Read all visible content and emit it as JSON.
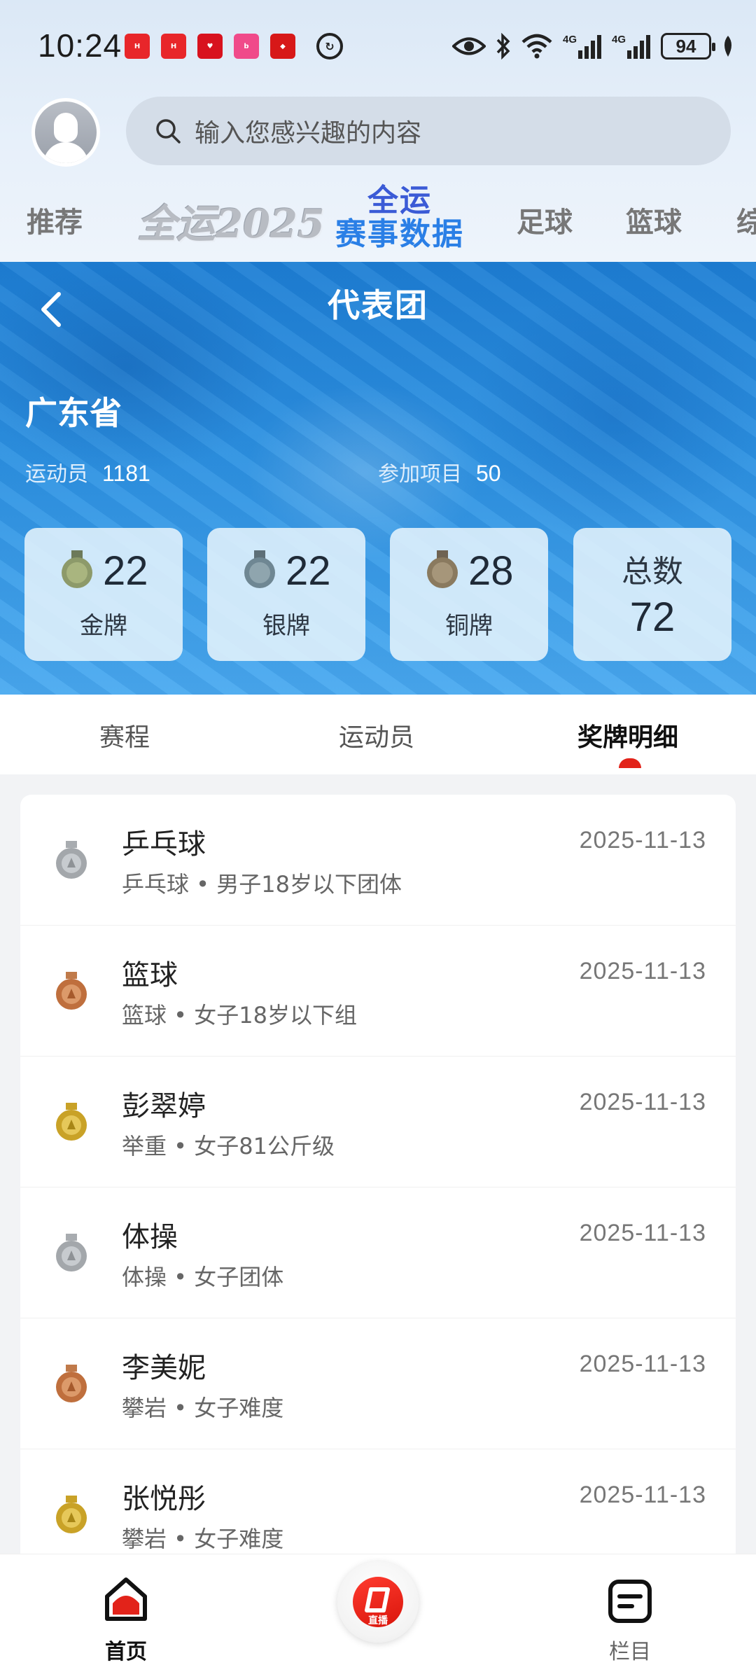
{
  "status_bar": {
    "time": "10:24",
    "battery": "94",
    "network_1": "4G",
    "network_2": "4G"
  },
  "search": {
    "placeholder": "输入您感兴趣的内容"
  },
  "channels": {
    "recommend": "推荐",
    "quanyun_2025": "全运2025",
    "data_line1": "全运",
    "data_line2": "赛事数据",
    "football": "足球",
    "basketball": "篮球",
    "more": "综"
  },
  "hero": {
    "title": "代表团",
    "team_name": "广东省",
    "athletes_label": "运动员",
    "athletes_value": "1181",
    "events_label": "参加项目",
    "events_value": "50"
  },
  "medals": {
    "gold_count": "22",
    "gold_label": "金牌",
    "silver_count": "22",
    "silver_label": "银牌",
    "bronze_count": "28",
    "bronze_label": "铜牌",
    "total_label": "总数",
    "total_count": "72"
  },
  "tabs": {
    "schedule": "赛程",
    "athletes": "运动员",
    "medal_detail": "奖牌明细"
  },
  "medal_list": [
    {
      "medal": "silver",
      "title": "乒乓球",
      "sub": "乒乓球 • 男子18岁以下团体",
      "date": "2025-11-13"
    },
    {
      "medal": "bronze",
      "title": "篮球",
      "sub": "篮球 • 女子18岁以下组",
      "date": "2025-11-13"
    },
    {
      "medal": "gold",
      "title": "彭翠婷",
      "sub": "举重 • 女子81公斤级",
      "date": "2025-11-13"
    },
    {
      "medal": "silver",
      "title": "体操",
      "sub": "体操 • 女子团体",
      "date": "2025-11-13"
    },
    {
      "medal": "bronze",
      "title": "李美妮",
      "sub": "攀岩 • 女子难度",
      "date": "2025-11-13"
    },
    {
      "medal": "gold",
      "title": "张悦彤",
      "sub": "攀岩 • 女子难度",
      "date": "2025-11-13"
    }
  ],
  "bottom_nav": {
    "home": "首页",
    "live": "直播",
    "columns": "栏目"
  },
  "colors": {
    "accent_red": "#e2231a",
    "hero_blue": "#2d92e2",
    "gold": "#c9a227",
    "silver": "#9ea3a8",
    "bronze": "#b8693a"
  }
}
